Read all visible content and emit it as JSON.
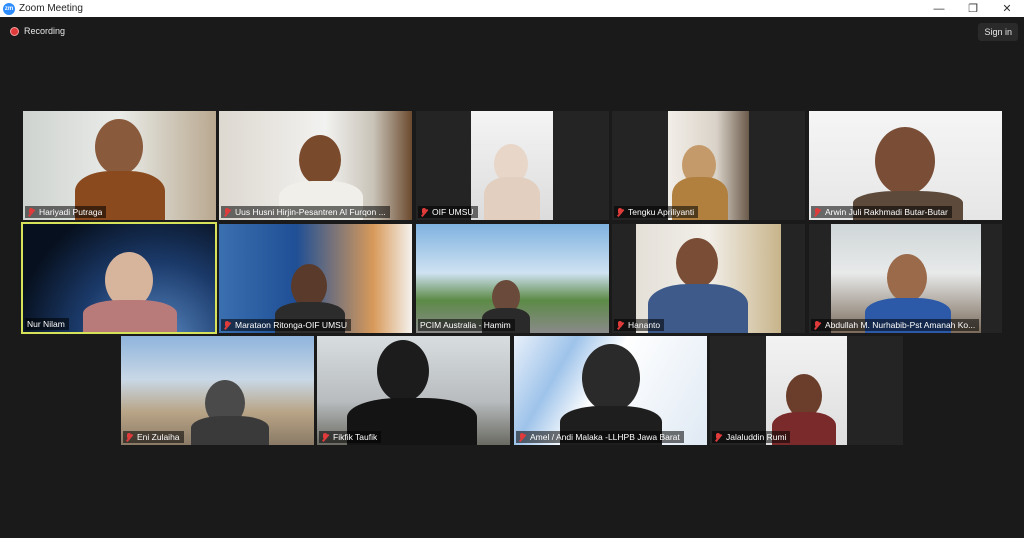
{
  "window": {
    "title": "Zoom Meeting",
    "app_icon_text": "zm",
    "minimize_glyph": "—",
    "maximize_glyph": "❐",
    "close_glyph": "✕"
  },
  "toolbar": {
    "recording_label": "Recording",
    "sign_in_label": "Sign in"
  },
  "participants": [
    {
      "name": "Hariyadi Putraga",
      "muted": true,
      "active": false
    },
    {
      "name": "Uus Husni Hirjin-Pesantren Al Furqon ...",
      "muted": true,
      "active": false
    },
    {
      "name": "OIF UMSU",
      "muted": true,
      "active": false
    },
    {
      "name": "Tengku Apriliyanti",
      "muted": true,
      "active": false
    },
    {
      "name": "Arwin Juli Rakhmadi Butar-Butar",
      "muted": true,
      "active": false
    },
    {
      "name": "Nur Nilam",
      "muted": false,
      "active": true
    },
    {
      "name": "Marataon Ritonga-OIF UMSU",
      "muted": true,
      "active": false
    },
    {
      "name": "PCIM Australia - Hamim",
      "muted": false,
      "active": false
    },
    {
      "name": "Hananto",
      "muted": true,
      "active": false
    },
    {
      "name": "Abdullah M. Nurhabib-Pst Amanah Ko...",
      "muted": true,
      "active": false
    },
    {
      "name": "Eni Zulaiha",
      "muted": true,
      "active": false
    },
    {
      "name": "Fikfik Taufik",
      "muted": true,
      "active": false
    },
    {
      "name": "Amel / Andi Malaka -LLHPB Jawa Barat",
      "muted": true,
      "active": false
    },
    {
      "name": "Jalaluddin Rumi",
      "muted": true,
      "active": false
    }
  ],
  "colors": {
    "background": "#1a1a1a",
    "active_speaker_border": "#d6e35a",
    "muted_icon": "#e03b3b",
    "recording": "#e03b3b"
  }
}
